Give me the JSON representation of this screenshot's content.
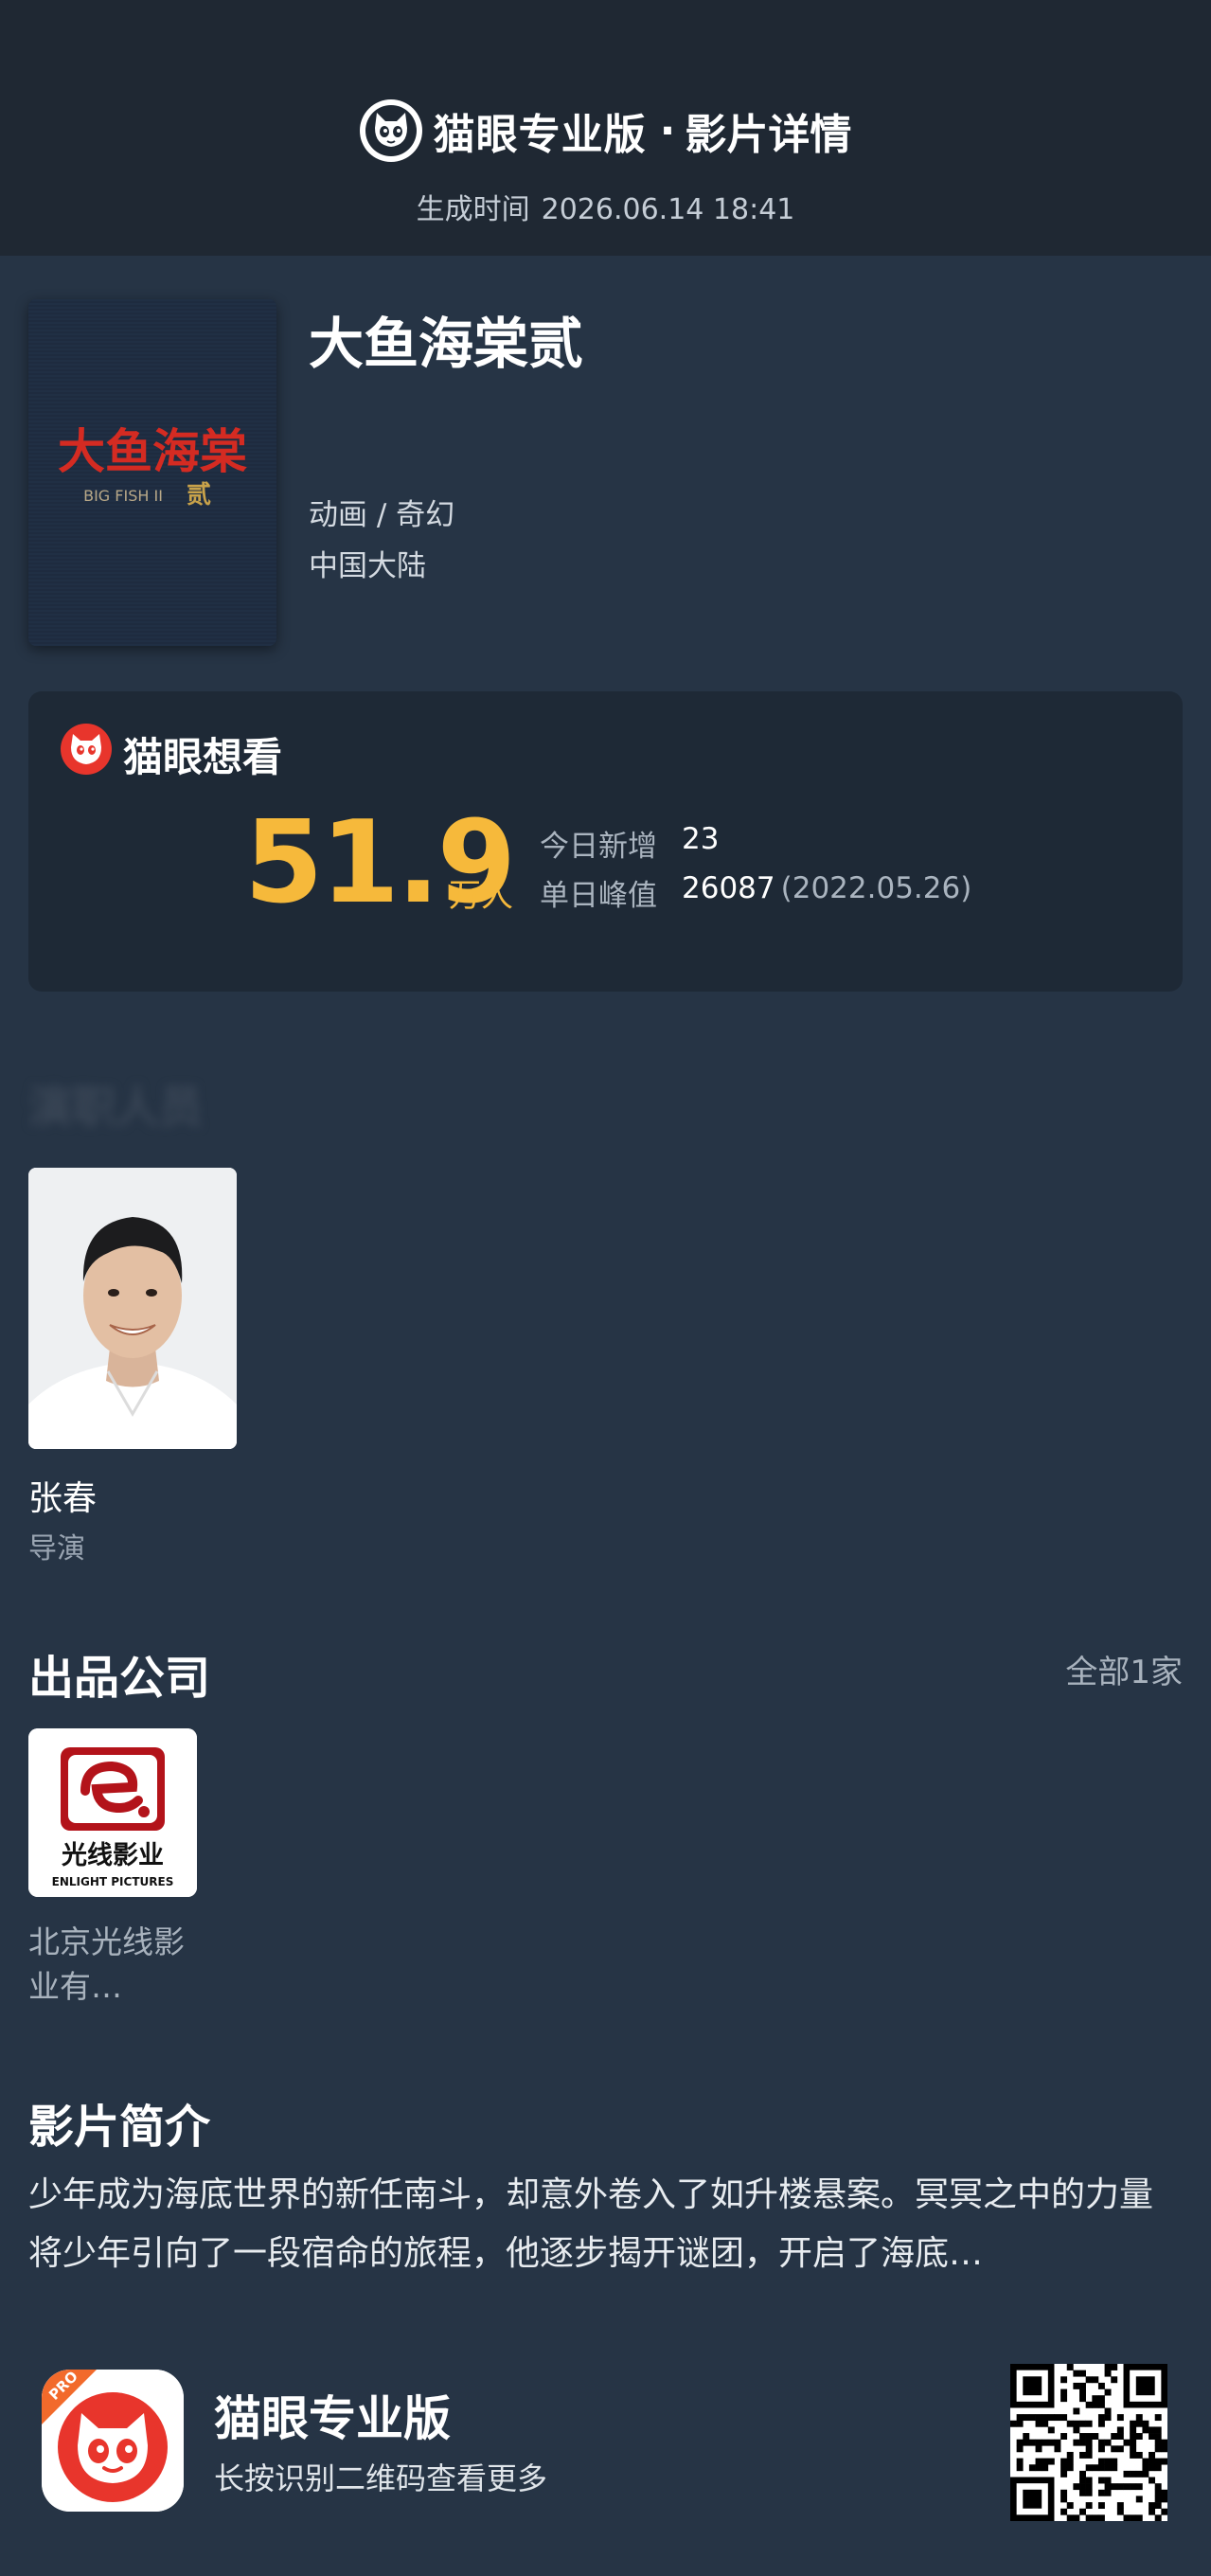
{
  "header": {
    "app_name": "猫眼专业版",
    "separator": "·",
    "page_name": "影片详情",
    "time_label": "生成时间",
    "time_value": "2026.06.14 18:41"
  },
  "movie": {
    "title": "大鱼海棠贰",
    "genre": "动画 / 奇幻",
    "region": "中国大陆",
    "poster_title": "大鱼海棠",
    "poster_sub": "BIG FISH II",
    "poster_mark": "贰"
  },
  "want_to_see": {
    "label": "猫眼想看",
    "count": "51.9",
    "unit": "万人",
    "today_label": "今日新增",
    "today_value": "23",
    "peak_label": "单日峰值",
    "peak_value": "26087",
    "peak_date": "(2022.05.26)"
  },
  "cast": {
    "heading": "演职人员",
    "members": [
      {
        "name": "张春",
        "role": "导演"
      }
    ]
  },
  "companies": {
    "title": "出品公司",
    "all_label": "全部1家",
    "items": [
      {
        "name": "北京光线影业有…",
        "logo_cn": "光线影业",
        "logo_en": "ENLIGHT PICTURES"
      }
    ]
  },
  "synopsis": {
    "title": "影片简介",
    "text": "少年成为海底世界的新任南斗，却意外卷入了如升楼悬案。冥冥之中的力量将少年引向了一段宿命的旅程，他逐步揭开谜团，开启了海底…"
  },
  "footer": {
    "app_name": "猫眼专业版",
    "tagline": "长按识别二维码查看更多",
    "badge": "PRO"
  },
  "colors": {
    "background": "#263445",
    "header": "#1f2833",
    "card": "#1e2936",
    "accent": "#f6b93b",
    "brand_red": "#e8352c"
  },
  "icons": [
    "maoyan-cat-logo-icon",
    "maoyan-cat-red-icon",
    "qr-code",
    "enlight-logo"
  ]
}
